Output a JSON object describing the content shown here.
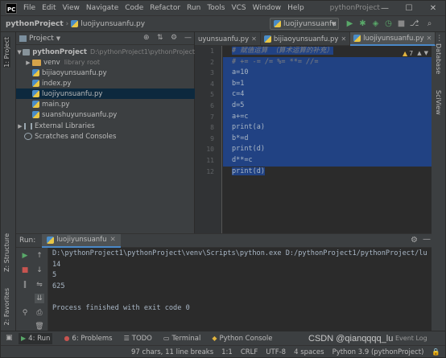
{
  "app": {
    "logo_text": "PC",
    "title": "pythonProject",
    "menu": [
      "File",
      "Edit",
      "View",
      "Navigate",
      "Code",
      "Refactor",
      "Run",
      "Tools",
      "VCS",
      "Window",
      "Help"
    ],
    "window_controls": [
      "—",
      "☐",
      "✕"
    ]
  },
  "navbar": {
    "project": "pythonProject",
    "file": "luojiyunsuanfu.py",
    "run_config": "luojiyunsuanfu"
  },
  "left_stripe": {
    "project_tab": "1: Project",
    "structure_tab": "Z: Structure",
    "favorites_tab": "2: Favorites"
  },
  "right_stripe": {
    "database_tab": "Database",
    "sciview_tab": "SciView"
  },
  "project_panel": {
    "title": "Project",
    "root": {
      "name": "pythonProject",
      "path": "D:\\pythonProject1\\pythonProject"
    },
    "venv": {
      "name": "venv",
      "note": "library root"
    },
    "files": [
      "bijiaoyunsuanfu.py",
      "index.py",
      "luojiyunsuanfu.py",
      "main.py",
      "suanshuyunsuanfu.py"
    ],
    "selected_file": "luojiyunsuanfu.py",
    "external": "External Libraries",
    "scratches": "Scratches and Consoles"
  },
  "editor": {
    "tabs": [
      {
        "label": "uyunsuanfu.py",
        "active": false
      },
      {
        "label": "bijiaoyunsuanfu.py",
        "active": false
      },
      {
        "label": "luojiyunsuanfu.py",
        "active": true
      }
    ],
    "warning_count": "7",
    "line_numbers": [
      "1",
      "2",
      "3",
      "4",
      "5",
      "6",
      "7",
      "8",
      "9",
      "10",
      "11",
      "12"
    ],
    "lines": [
      "# 赋值运算 （算术运算的补充）",
      "# += -= /= %= **= //=",
      "a=10",
      "b=1",
      "c=4",
      "d=5",
      "a+=c",
      "print(a)",
      "b*=d",
      "print(d)",
      "d**=c",
      "print(d)"
    ]
  },
  "run_panel": {
    "title": "Run:",
    "tab": "luojiyunsuanfu",
    "output": [
      "D:\\pythonProject1\\pythonProject\\venv\\Scripts\\python.exe D:/pythonProject1/pythonProject/lu",
      "14",
      "5",
      "625",
      "",
      "Process finished with exit code 0"
    ]
  },
  "bottom_tabs": [
    {
      "label": "4: Run",
      "icon": "play-icon"
    },
    {
      "label": "6: Problems",
      "icon": "problems-icon"
    },
    {
      "label": "TODO",
      "icon": "todo-icon"
    },
    {
      "label": "Terminal",
      "icon": "terminal-icon"
    },
    {
      "label": "Python Console",
      "icon": "python-icon"
    }
  ],
  "event_log": "Event Log",
  "status": {
    "chars": "97 chars, 11 line breaks",
    "position": "1:1",
    "line_sep": "CRLF",
    "encoding": "UTF-8",
    "indent": "4 spaces",
    "interpreter": "Python 3.9 (pythonProject)"
  },
  "watermark": "CSDN @qianqqqq_lu",
  "colors": {
    "selection": "#214283",
    "number": "#6897bb",
    "comment": "#808080",
    "builtin": "#8888c6",
    "run_green": "#59a869"
  }
}
